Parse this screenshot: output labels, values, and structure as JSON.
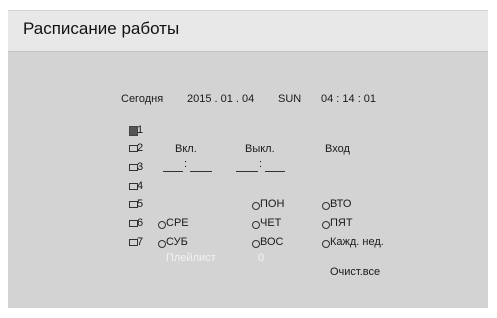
{
  "title": "Расписание работы",
  "clock": {
    "today_label": "Сегодня",
    "date": "2015 . 01 . 04",
    "day": "SUN",
    "time": "04 : 14 : 01"
  },
  "schedules": [
    "1",
    "2",
    "3",
    "4",
    "5",
    "6",
    "7"
  ],
  "columns": {
    "on": "Вкл.",
    "off": "Выкл.",
    "input": "Вход"
  },
  "time_sep": ":",
  "days": {
    "mon": "ПОН",
    "tue": "ВТО",
    "wed": "СРЕ",
    "thu": "ЧЕТ",
    "fri": "ПЯТ",
    "sat": "СУБ",
    "sun": "ВОС",
    "every_week": "Кажд. нед."
  },
  "playlist": {
    "label": "Плейлист",
    "value": "0"
  },
  "clear_all": "Очист.все",
  "colors": {
    "panel": "#d3d3d3",
    "titlebar": "#e8e8e8",
    "text": "#1a1a1a",
    "disabled": "#f2f2f2"
  }
}
